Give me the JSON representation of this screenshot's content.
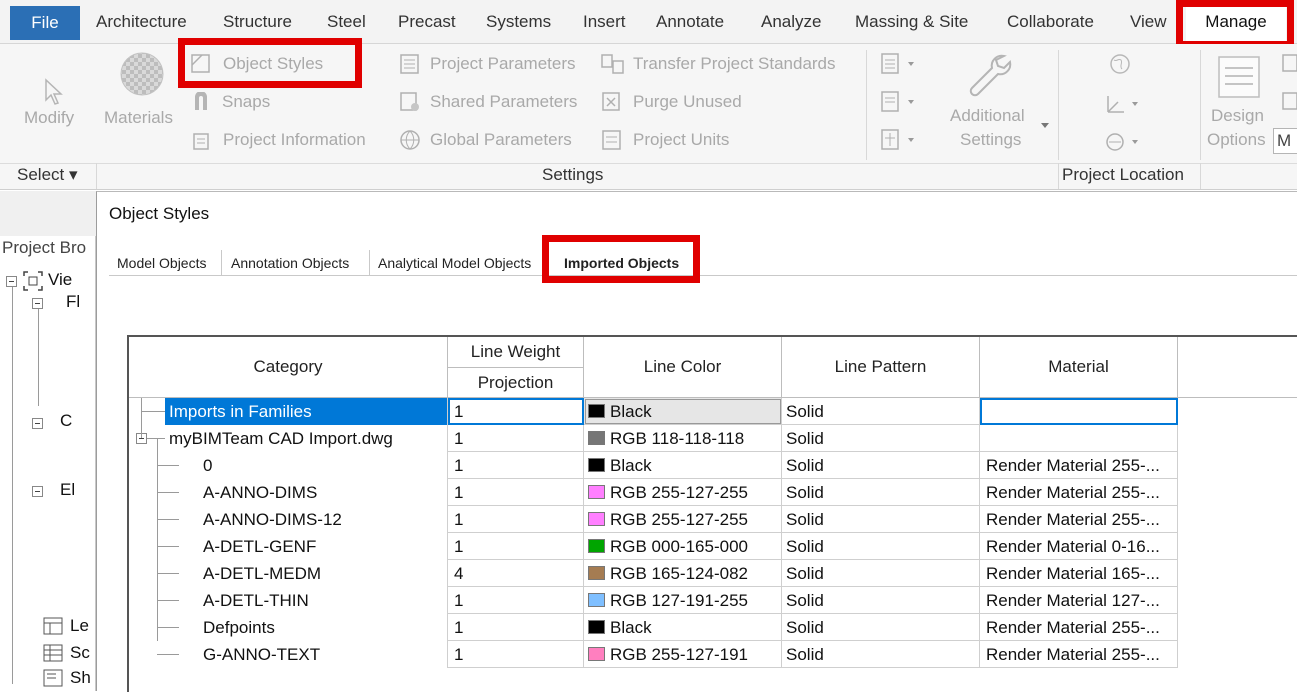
{
  "menu_tabs": [
    "File",
    "Architecture",
    "Structure",
    "Steel",
    "Precast",
    "Systems",
    "Insert",
    "Annotate",
    "Analyze",
    "Massing & Site",
    "Collaborate",
    "View",
    "Manage"
  ],
  "ribbon": {
    "modify": "Modify",
    "select": "Select ▾",
    "materials": "Materials",
    "object_styles": "Object Styles",
    "snaps": "Snaps",
    "project_information": "Project Information",
    "project_parameters": "Project Parameters",
    "shared_parameters": "Shared Parameters",
    "global_parameters": "Global Parameters",
    "transfer_project_standards": "Transfer Project Standards",
    "purge_unused": "Purge Unused",
    "project_units": "Project Units",
    "additional": "Additional",
    "settings": "Settings",
    "settings_panel": "Settings",
    "project_location_panel": "Project Location",
    "design": "Design",
    "options": "Options",
    "options_trunc": "M"
  },
  "project_browser": {
    "title": "Project Bro",
    "items": [
      "Vie",
      "Fl",
      "C",
      "El",
      "Le",
      "Sc",
      "Sh"
    ]
  },
  "dialog": {
    "title": "Object Styles",
    "tabs": [
      "Model Objects",
      "Annotation Objects",
      "Analytical Model Objects",
      "Imported Objects"
    ],
    "active_tab": "Imported Objects",
    "headers": {
      "category": "Category",
      "line_weight": "Line Weight",
      "projection": "Projection",
      "line_color": "Line Color",
      "line_pattern": "Line Pattern",
      "material": "Material"
    },
    "rows": [
      {
        "category": "Imports in Families",
        "weight": "1",
        "color_name": "Black",
        "swatch": "#000000",
        "pattern": "Solid",
        "material": "",
        "level": 0,
        "selected": true
      },
      {
        "category": "myBIMTeam CAD Import.dwg",
        "weight": "1",
        "color_name": "RGB 118-118-118",
        "swatch": "#767676",
        "pattern": "Solid",
        "material": "",
        "level": 0,
        "expanded": true
      },
      {
        "category": "0",
        "weight": "1",
        "color_name": "Black",
        "swatch": "#000000",
        "pattern": "Solid",
        "material": "Render Material 255-...",
        "level": 1
      },
      {
        "category": "A-ANNO-DIMS",
        "weight": "1",
        "color_name": "RGB 255-127-255",
        "swatch": "#ff7fff",
        "pattern": "Solid",
        "material": "Render Material 255-...",
        "level": 1
      },
      {
        "category": "A-ANNO-DIMS-12",
        "weight": "1",
        "color_name": "RGB 255-127-255",
        "swatch": "#ff7fff",
        "pattern": "Solid",
        "material": "Render Material 255-...",
        "level": 1
      },
      {
        "category": "A-DETL-GENF",
        "weight": "1",
        "color_name": "RGB 000-165-000",
        "swatch": "#00a500",
        "pattern": "Solid",
        "material": "Render Material 0-16...",
        "level": 1
      },
      {
        "category": "A-DETL-MEDM",
        "weight": "4",
        "color_name": "RGB 165-124-082",
        "swatch": "#a57c52",
        "pattern": "Solid",
        "material": "Render Material 165-...",
        "level": 1
      },
      {
        "category": "A-DETL-THIN",
        "weight": "1",
        "color_name": "RGB 127-191-255",
        "swatch": "#7fbfff",
        "pattern": "Solid",
        "material": "Render Material 127-...",
        "level": 1
      },
      {
        "category": "Defpoints",
        "weight": "1",
        "color_name": "Black",
        "swatch": "#000000",
        "pattern": "Solid",
        "material": "Render Material 255-...",
        "level": 1
      },
      {
        "category": "G-ANNO-TEXT",
        "weight": "1",
        "color_name": "RGB 255-127-191",
        "swatch": "#ff7fbf",
        "pattern": "Solid",
        "material": "Render Material 255-...",
        "level": 1
      }
    ]
  },
  "colors": {
    "highlight_red": "#e00000",
    "file_tab_blue": "#2b6fb5",
    "selection_blue": "#0078d7"
  }
}
